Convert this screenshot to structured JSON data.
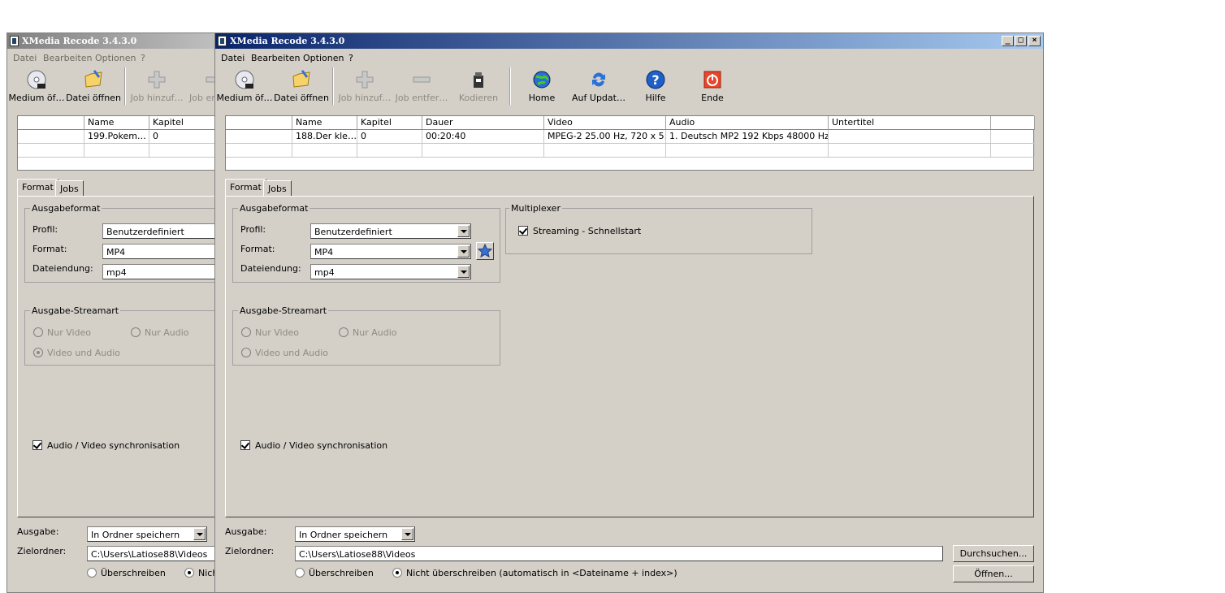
{
  "back_window": {
    "title": "XMedia Recode 3.4.3.0",
    "menu": [
      "Datei",
      "Bearbeiten",
      "Optionen",
      "?"
    ],
    "toolbar": [
      "Medium öf…",
      "Datei öffnen",
      "Job hinzuf…",
      "Job en"
    ],
    "grid": {
      "headers": [
        "",
        "Name",
        "Kapitel"
      ],
      "row": [
        "",
        "199.Pokem…",
        "0"
      ]
    },
    "tabs": [
      "Format",
      "Jobs"
    ],
    "ausgabeformat": {
      "title": "Ausgabeformat",
      "profil_label": "Profil:",
      "profil_value": "Benutzerdefiniert",
      "format_label": "Format:",
      "format_value": "MP4",
      "ext_label": "Dateiendung:",
      "ext_value": "mp4"
    },
    "streamart": {
      "title": "Ausgabe-Streamart",
      "nur_video": "Nur Video",
      "nur_audio": "Nur Audio",
      "video_audio": "Video und Audio"
    },
    "sync": "Audio / Video synchronisation",
    "ausgabe_label": "Ausgabe:",
    "ausgabe_value": "In Ordner speichern",
    "ziel_label": "Zielordner:",
    "ziel_value": "C:\\Users\\Latiose88\\Videos",
    "overwrite": "Überschreiben",
    "no_overwrite": "Nich"
  },
  "front_window": {
    "title": "XMedia Recode 3.4.3.0",
    "menu": [
      "Datei",
      "Bearbeiten",
      "Optionen",
      "?"
    ],
    "toolbar": {
      "open_disc": "Medium öf…",
      "open_file": "Datei öffnen",
      "add_job": "Job hinzuf…",
      "remove_job": "Job entfer…",
      "encode": "Kodieren",
      "home": "Home",
      "update": "Auf Updat…",
      "help": "Hilfe",
      "exit": "Ende"
    },
    "grid": {
      "headers": [
        "",
        "Name",
        "Kapitel",
        "Dauer",
        "Video",
        "Audio",
        "Untertitel",
        ""
      ],
      "row": [
        "",
        "188.Der kle…",
        "0",
        "00:20:40",
        "MPEG-2 25.00 Hz, 720 x 5…",
        "1. Deutsch MP2 192 Kbps 48000 Hz …",
        "",
        ""
      ]
    },
    "tabs": [
      "Format",
      "Jobs"
    ],
    "ausgabeformat": {
      "title": "Ausgabeformat",
      "profil_label": "Profil:",
      "profil_value": "Benutzerdefiniert",
      "format_label": "Format:",
      "format_value": "MP4",
      "ext_label": "Dateiendung:",
      "ext_value": "mp4"
    },
    "multiplexer": {
      "title": "Multiplexer",
      "streaming": "Streaming - Schnellstart"
    },
    "streamart": {
      "title": "Ausgabe-Streamart",
      "nur_video": "Nur Video",
      "nur_audio": "Nur Audio",
      "video_audio": "Video und Audio"
    },
    "sync": "Audio / Video synchronisation",
    "ausgabe_label": "Ausgabe:",
    "ausgabe_value": "In Ordner speichern",
    "ziel_label": "Zielordner:",
    "ziel_value": "C:\\Users\\Latiose88\\Videos",
    "browse": "Durchsuchen...",
    "open": "Öffnen...",
    "overwrite": "Überschreiben",
    "no_overwrite": "Nicht überschreiben (automatisch in <Dateiname + index>)"
  },
  "colors": {
    "titlebar_active": "#0a246a",
    "titlebar_active_end": "#a6caf0",
    "titlebar_inactive": "#808080",
    "face": "#d4d0c8"
  }
}
